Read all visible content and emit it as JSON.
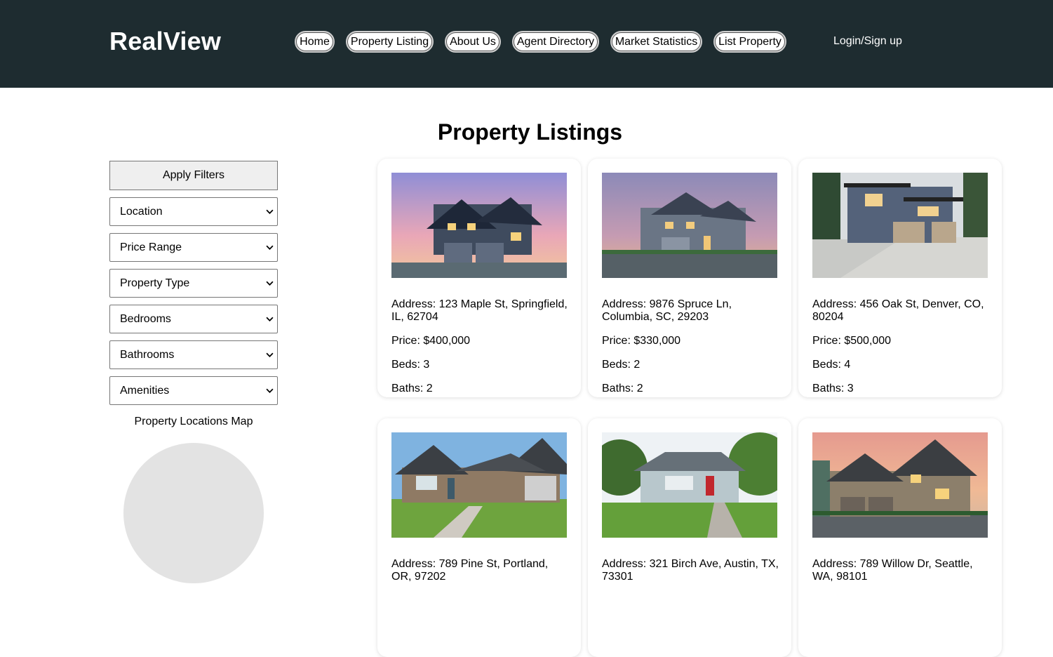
{
  "header": {
    "logo": "RealView",
    "nav": [
      "Home",
      "Property Listing",
      "About Us",
      "Agent Directory",
      "Market Statistics",
      "List Property"
    ],
    "login": "Login/Sign up",
    "background": "#1e2c30"
  },
  "main": {
    "title": "Property Listings"
  },
  "sidebar": {
    "apply_label": "Apply Filters",
    "filters": [
      "Location",
      "Price Range",
      "Property Type",
      "Bedrooms",
      "Bathrooms",
      "Amenities"
    ],
    "map_label": "Property Locations Map"
  },
  "listings": [
    {
      "address": "Address: 123 Maple St, Springfield, IL, 62704",
      "price": "Price: $400,000",
      "beds": "Beds: 3",
      "baths": "Baths: 2",
      "image": "house-photo-dusk-blue"
    },
    {
      "address": "Address: 9876 Spruce Ln, Columbia, SC, 29203",
      "price": "Price: $330,000",
      "beds": "Beds: 2",
      "baths": "Baths: 2",
      "image": "house-photo-dusk-grey"
    },
    {
      "address": "Address: 456 Oak St, Denver, CO, 80204",
      "price": "Price: $500,000",
      "beds": "Beds: 4",
      "baths": "Baths: 3",
      "image": "house-photo-modern"
    },
    {
      "address": "Address: 789 Pine St, Portland, OR, 97202",
      "price": "",
      "beds": "",
      "baths": "",
      "image": "house-photo-ranch"
    },
    {
      "address": "Address: 321 Birch Ave, Austin, TX, 73301",
      "price": "",
      "beds": "",
      "baths": "",
      "image": "house-photo-cottage"
    },
    {
      "address": "Address: 789 Willow Dr, Seattle, WA, 98101",
      "price": "",
      "beds": "",
      "baths": "",
      "image": "house-photo-evening"
    }
  ]
}
